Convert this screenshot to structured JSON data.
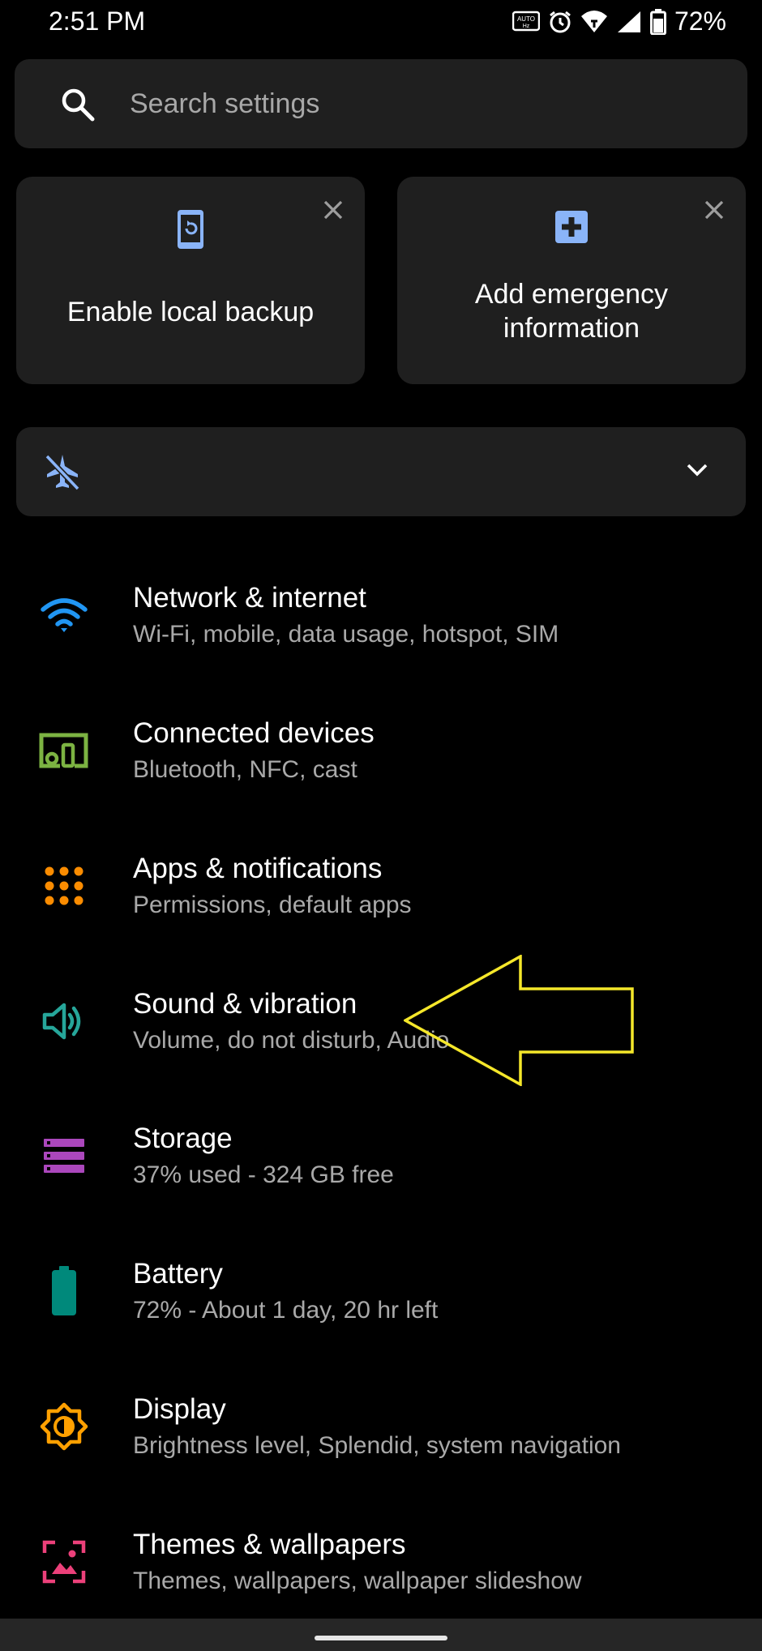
{
  "status_bar": {
    "time": "2:51 PM",
    "battery_percent": "72%"
  },
  "search": {
    "placeholder": "Search settings"
  },
  "suggestions": [
    {
      "title": "Enable local backup",
      "icon": "backup-phone-icon"
    },
    {
      "title_line1": "Add emergency",
      "title_line2": "information",
      "icon": "medical-plus-icon"
    }
  ],
  "conditional": {
    "icon": "airplane-mode-off-icon",
    "expand_icon": "chevron-down-icon"
  },
  "settings": [
    {
      "title": "Network & internet",
      "subtitle": "Wi-Fi, mobile, data usage, hotspot, SIM",
      "icon": "wifi-icon",
      "color": "#2196f3"
    },
    {
      "title": "Connected devices",
      "subtitle": "Bluetooth, NFC, cast",
      "icon": "connected-devices-icon",
      "color": "#7cb342"
    },
    {
      "title": "Apps & notifications",
      "subtitle": "Permissions, default apps",
      "icon": "apps-grid-icon",
      "color": "#fb8c00"
    },
    {
      "title": "Sound & vibration",
      "subtitle": "Volume, do not disturb, Audio",
      "icon": "volume-icon",
      "color": "#26a69a"
    },
    {
      "title": "Storage",
      "subtitle": "37% used - 324 GB free",
      "icon": "storage-icon",
      "color": "#ab47bc"
    },
    {
      "title": "Battery",
      "subtitle": "72% - About 1 day, 20 hr left",
      "icon": "battery-icon",
      "color": "#00897b"
    },
    {
      "title": "Display",
      "subtitle": "Brightness level, Splendid, system navigation",
      "icon": "brightness-icon",
      "color": "#ffa000"
    },
    {
      "title": "Themes & wallpapers",
      "subtitle": "Themes, wallpapers, wallpaper slideshow",
      "icon": "wallpaper-icon",
      "color": "#ec407a"
    }
  ],
  "annotation": {
    "icon": "yellow-arrow-annotation",
    "color": "#f5e72a"
  }
}
